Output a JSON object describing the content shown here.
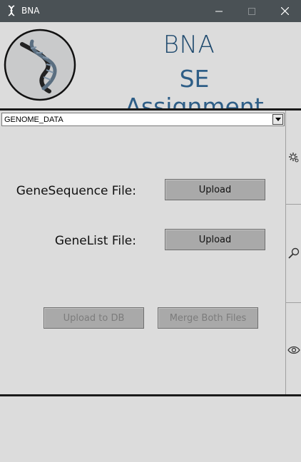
{
  "window": {
    "title": "BNA",
    "app_icon": "dna-icon",
    "controls": [
      "minimize-icon",
      "maximize-icon",
      "close-icon"
    ]
  },
  "header": {
    "logo": "dna-logo",
    "brand_name": "BNA",
    "subtitle": "SE Assignment"
  },
  "dataset_select": {
    "selected": "GENOME_DATA"
  },
  "form": {
    "gene_sequence_label": "GeneSequence File:",
    "gene_sequence_button": "Upload",
    "gene_list_label": "GeneList File:",
    "gene_list_button": "Upload",
    "upload_db_button": "Upload to DB",
    "merge_button": "Merge Both Files"
  },
  "rail": {
    "icons": [
      "settings-icon",
      "search-icon",
      "eye-icon"
    ]
  },
  "colors": {
    "titlebar": "#4a5155",
    "brand": "#1f4a6e",
    "background": "#dcdcdc",
    "button": "#a9a9a9"
  }
}
